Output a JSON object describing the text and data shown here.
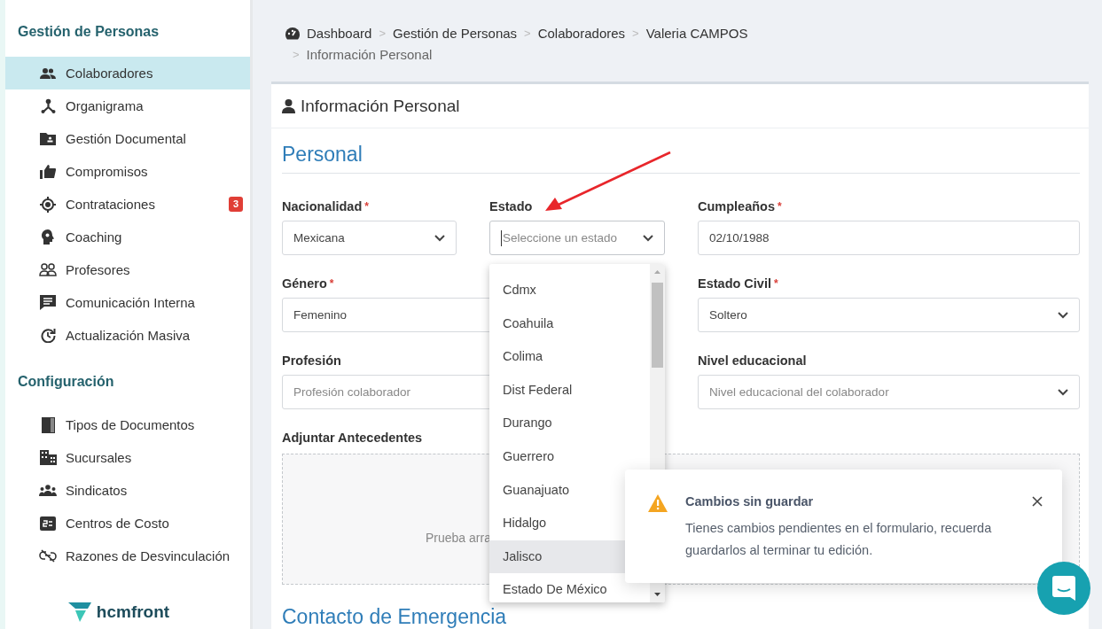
{
  "sidebar": {
    "sections": [
      {
        "title": "Gestión de Personas",
        "items": [
          {
            "label": "Colaboradores",
            "selected": true
          },
          {
            "label": "Organigrama",
            "selected": false
          },
          {
            "label": "Gestión Documental",
            "selected": false
          },
          {
            "label": "Compromisos",
            "selected": false
          },
          {
            "label": "Contrataciones",
            "selected": false,
            "badge": "3"
          },
          {
            "label": "Coaching",
            "selected": false
          },
          {
            "label": "Profesores",
            "selected": false
          },
          {
            "label": "Comunicación Interna",
            "selected": false
          },
          {
            "label": "Actualización Masiva",
            "selected": false
          }
        ]
      },
      {
        "title": "Configuración",
        "items": [
          {
            "label": "Tipos de Documentos",
            "selected": false
          },
          {
            "label": "Sucursales",
            "selected": false
          },
          {
            "label": "Sindicatos",
            "selected": false
          },
          {
            "label": "Centros de Costo",
            "selected": false
          },
          {
            "label": "Razones de Desvinculación",
            "selected": false
          }
        ]
      }
    ],
    "logo": "hcmfront"
  },
  "breadcrumb": {
    "separator": ">",
    "items": [
      "Dashboard",
      "Gestión de Personas",
      "Colaboradores",
      "Valeria CAMPOS",
      "Información Personal"
    ]
  },
  "card": {
    "title": "Información Personal",
    "section_title": "Personal",
    "required_mark": "*",
    "fields": [
      {
        "label": "Nacionalidad",
        "required": true,
        "kind": "select",
        "value": "Mexicana"
      },
      {
        "label": "Estado",
        "required": false,
        "kind": "select",
        "placeholder": "Seleccione un estado",
        "focused": true
      },
      {
        "label": "Cumpleaños",
        "required": true,
        "kind": "input",
        "value": "02/10/1988"
      },
      {
        "label": "Género",
        "required": true,
        "kind": "input",
        "value": "Femenino"
      },
      {
        "label": "Estado Civil",
        "required": true,
        "kind": "select",
        "value": "Soltero"
      },
      {
        "label": "Profesión",
        "required": false,
        "kind": "input",
        "placeholder": "Profesión colaborador"
      },
      {
        "label": "Nivel educacional",
        "required": false,
        "kind": "select",
        "placeholder": "Nivel educacional del colaborador"
      }
    ],
    "attachments": {
      "label": "Adjuntar Antecedentes",
      "hint": "Prueba arra"
    },
    "next_section_title": "Contacto de Emergencia"
  },
  "dropdown": {
    "options": [
      {
        "label": "Cdmx",
        "selected": false
      },
      {
        "label": "Coahuila",
        "selected": false
      },
      {
        "label": "Colima",
        "selected": false
      },
      {
        "label": "Dist Federal",
        "selected": false
      },
      {
        "label": "Durango",
        "selected": false
      },
      {
        "label": "Guerrero",
        "selected": false
      },
      {
        "label": "Guanajuato",
        "selected": false
      },
      {
        "label": "Hidalgo",
        "selected": false
      },
      {
        "label": "Jalisco",
        "selected": true
      },
      {
        "label": "Estado De México",
        "selected": false
      }
    ]
  },
  "toast": {
    "title": "Cambios sin guardar",
    "message": "Tienes cambios pendientes en el formulario, recuerda guardarlos al terminar tu edición."
  }
}
